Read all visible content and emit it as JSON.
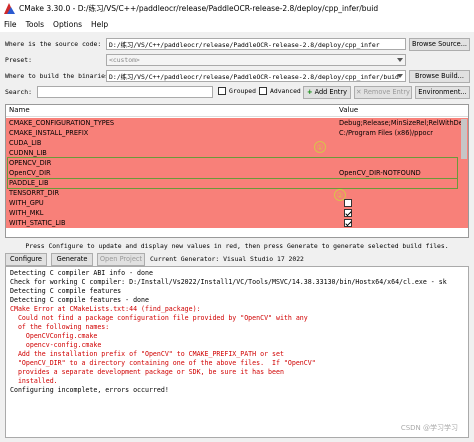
{
  "window": {
    "title": "CMake 3.30.0 - D:/练习/VS/C++/paddleocr/release/PaddleOCR-release-2.8/deploy/cpp_infer/buid"
  },
  "menu": [
    "File",
    "Tools",
    "Options",
    "Help"
  ],
  "source": {
    "label": "Where is the source code:",
    "value": "D:/练习/VS/C++/paddleocr/release/PaddleOCR-release-2.8/deploy/cpp_infer",
    "button": "Browse Source..."
  },
  "preset": {
    "label": "Preset:",
    "value": "<custom>"
  },
  "build": {
    "label": "Where to build the binaries:",
    "value": "D:/练习/VS/C++/paddleocr/release/PaddleOCR-release-2.8/deploy/cpp_infer/buid",
    "button": "Browse Build..."
  },
  "search": {
    "label": "Search:",
    "value": "",
    "grouped": "Grouped",
    "advanced": "Advanced",
    "add_entry": "Add Entry",
    "remove_entry": "Remove Entry",
    "environment": "Environment..."
  },
  "table": {
    "col_name": "Name",
    "col_value": "Value",
    "rows": [
      {
        "name": "CMAKE_CONFIGURATION_TYPES",
        "value": "Debug;Release;MinSizeRel;RelWithDeb"
      },
      {
        "name": "CMAKE_INSTALL_PREFIX",
        "value": "C:/Program Files (x86)/ppocr"
      },
      {
        "name": "CUDA_LIB",
        "value": ""
      },
      {
        "name": "CUDNN_LIB",
        "value": ""
      },
      {
        "name": "OPENCV_DIR",
        "value": ""
      },
      {
        "name": "OpenCV_DIR",
        "value": "OpenCV_DIR-NOTFOUND"
      },
      {
        "name": "PADDLE_LIB",
        "value": ""
      },
      {
        "name": "TENSORRT_DIR",
        "value": ""
      },
      {
        "name": "WITH_GPU",
        "value": "",
        "checkbox": true,
        "checked": false
      },
      {
        "name": "WITH_MKL",
        "value": "",
        "checkbox": true,
        "checked": true
      },
      {
        "name": "WITH_STATIC_LIB",
        "value": "",
        "checkbox": true,
        "checked": true
      }
    ],
    "annotations": [
      "①",
      "②"
    ]
  },
  "hint": "Press Configure to update and display new values in red, then press Generate to generate selected build files.",
  "actions": {
    "configure": "Configure",
    "generate": "Generate",
    "open_project": "Open Project",
    "generator": "Current Generator: Visual Studio 17 2022"
  },
  "output": [
    {
      "t": "Detecting C compiler ABI info - done",
      "e": false
    },
    {
      "t": "Check for working C compiler: D:/Install/Vs2022/Install1/VC/Tools/MSVC/14.38.33130/bin/Hostx64/x64/cl.exe - sk",
      "e": false
    },
    {
      "t": "Detecting C compile features",
      "e": false
    },
    {
      "t": "Detecting C compile features - done",
      "e": false
    },
    {
      "t": "CMake Error at CMakeLists.txt:44 (find_package):",
      "e": true
    },
    {
      "t": "  Could not find a package configuration file provided by \"OpenCV\" with any",
      "e": true
    },
    {
      "t": "  of the following names:",
      "e": true
    },
    {
      "t": "",
      "e": true
    },
    {
      "t": "    OpenCVConfig.cmake",
      "e": true
    },
    {
      "t": "    opencv-config.cmake",
      "e": true
    },
    {
      "t": "",
      "e": true
    },
    {
      "t": "  Add the installation prefix of \"OpenCV\" to CMAKE_PREFIX_PATH or set",
      "e": true
    },
    {
      "t": "  \"OpenCV_DIR\" to a directory containing one of the above files.  If \"OpenCV\"",
      "e": true
    },
    {
      "t": "  provides a separate development package or SDK, be sure it has been",
      "e": true
    },
    {
      "t": "  installed.",
      "e": true
    },
    {
      "t": "",
      "e": false
    },
    {
      "t": "",
      "e": false
    },
    {
      "t": "Configuring incomplete, errors occurred!",
      "e": false
    }
  ],
  "watermark": "CSDN @学习学习"
}
